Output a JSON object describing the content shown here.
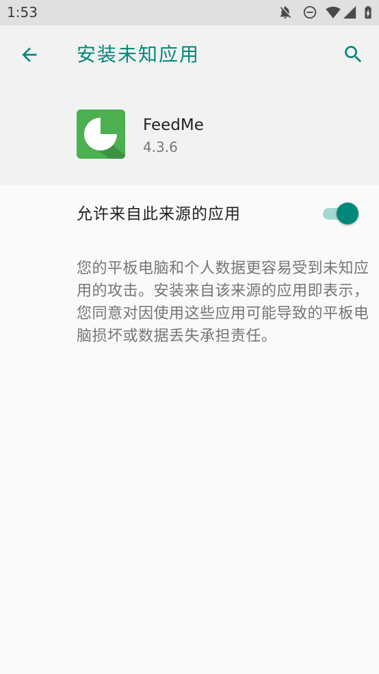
{
  "status_bar": {
    "time": "1:53",
    "icons": [
      "notifications-off-icon",
      "do-not-disturb-icon",
      "wifi-icon",
      "cell-signal-icon",
      "battery-charging-icon"
    ]
  },
  "toolbar": {
    "title": "安装未知应用",
    "back_icon": "back-arrow-icon",
    "search_icon": "search-icon"
  },
  "app": {
    "name": "FeedMe",
    "version": "4.3.6",
    "icon": "feedme-app-icon"
  },
  "setting": {
    "label": "允许来自此来源的应用",
    "enabled": true
  },
  "description_lines": [
    "您的平板电脑和个人数据更容易受到未知应",
    "用的攻击。安装来自该来源的应用即表示，",
    "您同意对因使用这些应用可能导致的平板电",
    "脑损坏或数据丢失承担责任。"
  ],
  "colors": {
    "accent": "#00897b",
    "app_icon": "#4caf50",
    "header_bg": "#f2f2f2",
    "page_bg": "#fafafa",
    "status_bar_bg": "#e0e0e0"
  }
}
